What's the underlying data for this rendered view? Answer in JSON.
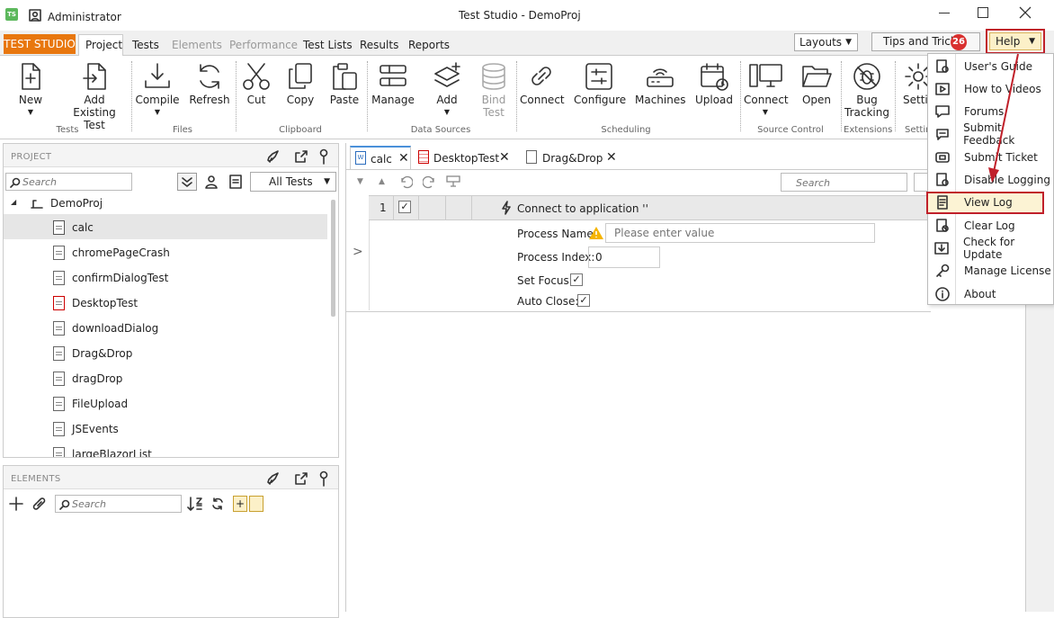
{
  "window": {
    "user": "Administrator",
    "title": "Test Studio - DemoProj"
  },
  "ribbon": {
    "brand_tab": "TEST STUDIO",
    "tabs": [
      "Project",
      "Tests",
      "Elements",
      "Performance",
      "Test Lists",
      "Results",
      "Reports"
    ],
    "layouts_label": "Layouts",
    "tips_label": "Tips and Tricks",
    "tips_badge": "26",
    "help_label": "Help",
    "buttons": {
      "new": "New",
      "add_existing_1": "Add",
      "add_existing_2": "Existing Test",
      "compile": "Compile",
      "refresh": "Refresh",
      "cut": "Cut",
      "copy": "Copy",
      "paste": "Paste",
      "manage": "Manage",
      "add": "Add",
      "bind_1": "Bind",
      "bind_2": "Test",
      "connect": "Connect",
      "configure": "Configure",
      "machines": "Machines",
      "upload": "Upload",
      "sc_connect": "Connect",
      "open": "Open",
      "bug_1": "Bug",
      "bug_2": "Tracking",
      "settings": "Setti"
    },
    "groups": {
      "tests": "Tests",
      "files": "Files",
      "clipboard": "Clipboard",
      "data_sources": "Data Sources",
      "scheduling": "Scheduling",
      "source_control": "Source Control",
      "extensions": "Extensions",
      "settings": "Settin"
    }
  },
  "project_panel": {
    "header": "PROJECT",
    "search_placeholder": "Search",
    "filter_value": "All Tests",
    "root": "DemoProj",
    "items": [
      {
        "name": "calc",
        "selected": true,
        "type": "web"
      },
      {
        "name": "chromePageCrash",
        "type": "test"
      },
      {
        "name": "confirmDialogTest",
        "type": "test"
      },
      {
        "name": "DesktopTest",
        "type": "desktop"
      },
      {
        "name": "downloadDialog",
        "type": "test"
      },
      {
        "name": "Drag&Drop",
        "type": "locked"
      },
      {
        "name": "dragDrop",
        "type": "test"
      },
      {
        "name": "FileUpload",
        "type": "locked"
      },
      {
        "name": "JSEvents",
        "type": "test"
      },
      {
        "name": "largeBlazorList",
        "type": "test"
      }
    ]
  },
  "elements_panel": {
    "header": "ELEMENTS",
    "search_placeholder": "Search"
  },
  "doc_tabs": [
    "calc",
    "DesktopTest",
    "Drag&Drop"
  ],
  "step_grid": {
    "search_placeholder": "Search",
    "row_number": "1",
    "step_title": "Connect to application ''",
    "process_name_label": "Process Name:",
    "process_name_placeholder": "Please enter value",
    "process_index_label": "Process Index:",
    "process_index_value": "0",
    "set_focus_label": "Set Focus:",
    "auto_close_label": "Auto Close:"
  },
  "help_menu": {
    "items": [
      {
        "label": "User's Guide",
        "icon": "guide-icon"
      },
      {
        "label": "How to Videos",
        "icon": "video-icon"
      },
      {
        "label": "Forums",
        "icon": "forum-icon"
      },
      {
        "label": "Submit Feedback",
        "icon": "feedback-icon"
      },
      {
        "label": "Submit Ticket",
        "icon": "ticket-icon"
      },
      {
        "label": "Disable Logging",
        "icon": "disable-log-icon"
      },
      {
        "label": "View Log",
        "icon": "view-log-icon",
        "highlighted": true
      },
      {
        "label": "Clear Log",
        "icon": "clear-log-icon"
      },
      {
        "label": "Check for Update",
        "icon": "update-icon"
      },
      {
        "label": "Manage License",
        "icon": "key-icon"
      },
      {
        "label": "About",
        "icon": "info-icon"
      }
    ]
  },
  "colors": {
    "brand_orange": "#e8770e",
    "highlight_red": "#c0202a",
    "badge_red": "#d9302f",
    "selection_yellow": "#fcf3d4"
  }
}
